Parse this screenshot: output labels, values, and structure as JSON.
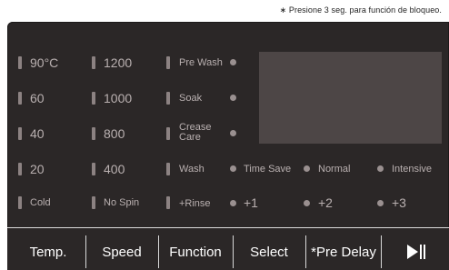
{
  "note": "∗ Presione 3 seg. para función de bloqueo.",
  "temp": [
    "90°C",
    "60",
    "40",
    "20",
    "Cold"
  ],
  "speed": [
    "1200",
    "1000",
    "800",
    "400",
    "No Spin"
  ],
  "function": [
    "Pre Wash",
    "Soak",
    "Crease\nCare",
    "Wash",
    "+Rinse"
  ],
  "wash_options": [
    "Time Save",
    "Normal",
    "Intensive"
  ],
  "rinse_options": [
    "+1",
    "+2",
    "+3"
  ],
  "buttons": {
    "temp": "Temp.",
    "speed": "Speed",
    "function": "Function",
    "select": "Select",
    "predelay": "*Pre Delay"
  },
  "icons": {
    "start_pause": "play-pause-icon"
  }
}
